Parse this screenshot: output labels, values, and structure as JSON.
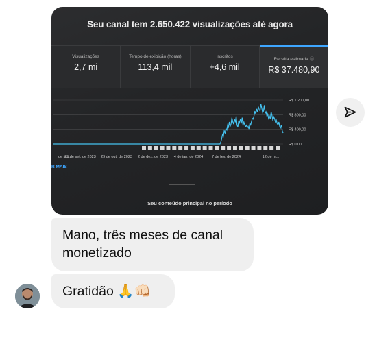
{
  "photo": {
    "headline": "Seu canal tem 2.650.422 visualizações até agora",
    "stats": [
      {
        "label": "Visualizações",
        "value": "2,7 mi"
      },
      {
        "label": "Tempo de exibição (horas)",
        "value": "113,4 mil"
      },
      {
        "label": "Inscritos",
        "value": "+4,6 mil"
      },
      {
        "label": "Receita estimada",
        "value": "R$ 37.480,90",
        "icon": "info-icon"
      }
    ],
    "ver_mais": "R MAIS",
    "footer": "Seu conteúdo principal no período"
  },
  "chart_data": {
    "type": "line",
    "x": [
      "de ag...",
      "25 de set. de 2023",
      "29 de out. de 2023",
      "2 de dez. de 2023",
      "4 de jan. de 2024",
      "7 de fev. de 2024",
      "12 de m..."
    ],
    "y_ticks": [
      "R$ 1.200,00",
      "R$ 800,00",
      "R$ 400,00",
      "R$ 0,00"
    ],
    "ylim": [
      0,
      1200
    ],
    "series": [
      {
        "values": [
          0,
          0,
          0,
          0,
          0,
          0,
          0,
          0,
          0,
          0,
          0,
          0,
          0,
          0,
          0,
          0,
          0,
          0,
          0,
          0,
          0,
          0,
          0,
          0,
          0,
          0,
          0,
          0,
          0,
          0,
          0,
          0,
          0,
          0,
          0,
          0,
          0,
          0,
          0,
          0,
          0,
          0,
          0,
          0,
          0,
          0,
          0,
          0,
          0,
          0,
          0,
          0,
          0,
          0,
          0,
          0,
          0,
          0,
          0,
          0,
          0,
          0,
          0,
          0,
          0,
          0,
          0,
          0,
          0,
          0,
          0,
          0,
          0,
          0,
          0,
          0,
          0,
          0,
          0,
          0,
          0,
          0,
          0,
          0,
          0,
          0,
          0,
          0,
          0,
          0,
          0,
          0,
          0,
          0,
          0,
          0,
          0,
          0,
          0,
          0,
          0,
          0,
          0,
          0,
          0,
          0,
          0,
          0,
          0,
          0,
          0,
          0,
          0,
          0,
          0,
          0,
          0,
          0,
          0,
          0,
          0,
          0,
          0,
          0,
          0,
          0,
          0,
          0,
          0,
          0,
          0,
          0,
          0,
          0,
          0,
          0,
          0,
          0,
          0,
          0,
          0,
          0,
          0,
          0,
          0,
          0,
          0,
          0,
          0,
          0,
          0,
          0,
          0,
          0,
          0,
          0,
          0,
          0,
          0,
          0,
          0,
          0,
          0,
          0,
          0,
          0,
          0,
          0,
          0,
          0,
          0,
          0,
          0,
          0,
          0,
          0,
          0,
          0,
          0,
          0,
          0,
          0,
          0,
          0,
          0,
          0,
          0,
          0,
          0,
          0,
          0,
          0,
          0,
          0,
          0,
          0,
          0,
          60,
          140,
          260,
          210,
          360,
          300,
          420,
          380,
          520,
          460,
          600,
          480,
          550,
          720,
          610,
          540,
          680,
          590,
          760,
          520,
          460,
          640,
          580,
          690,
          560,
          720,
          500,
          600,
          520,
          470,
          510,
          440,
          480,
          410,
          560,
          520,
          620,
          700,
          680,
          780,
          900,
          820,
          960,
          880,
          1020,
          940,
          900,
          1100,
          980,
          860,
          900,
          1060,
          840,
          880,
          760,
          820,
          700,
          760,
          690,
          880,
          780,
          640,
          740,
          690,
          600,
          660,
          560,
          520,
          600,
          480,
          440,
          520,
          360,
          300
        ]
      }
    ],
    "annotation_markers": 23
  },
  "messages": [
    {
      "text_line1": "Mano, três meses de canal",
      "text_line2": "monetizado"
    },
    {
      "text": "Gratidão 🙏👊🏻"
    }
  ],
  "icons": {
    "share": "send-icon",
    "avatar": "avatar"
  },
  "colors": {
    "accent": "#3ea6ff",
    "line": "#45c2f0",
    "bubble": "#efefef"
  }
}
